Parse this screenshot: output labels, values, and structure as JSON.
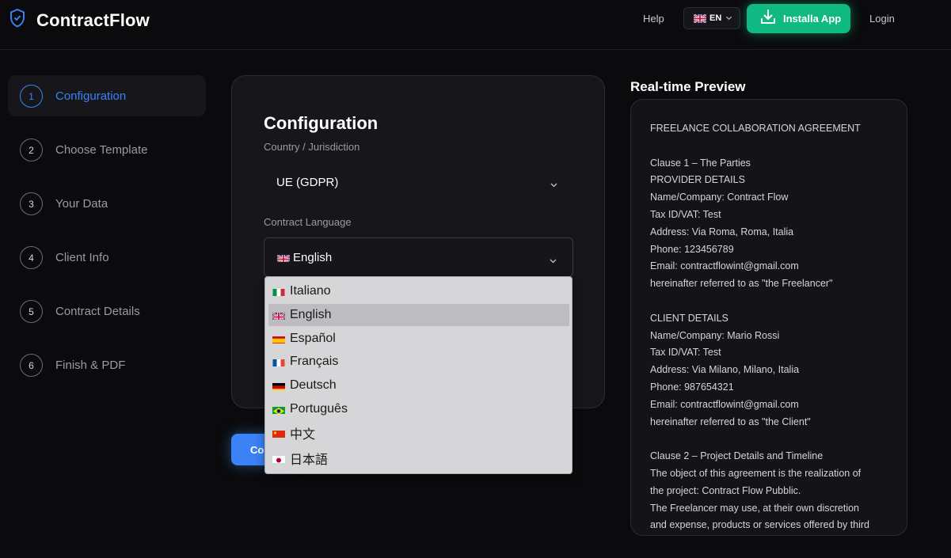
{
  "header": {
    "app_title": "ContractFlow",
    "help_label": "Help",
    "lang_button": "EN",
    "install_label": "Installa App",
    "login_label": "Login"
  },
  "steps": [
    {
      "num": "1",
      "label": "Configuration"
    },
    {
      "num": "2",
      "label": "Choose Template"
    },
    {
      "num": "3",
      "label": "Your Data"
    },
    {
      "num": "4",
      "label": "Client Info"
    },
    {
      "num": "5",
      "label": "Contract Details"
    },
    {
      "num": "6",
      "label": "Finish & PDF"
    }
  ],
  "config": {
    "title": "Configuration",
    "country_label": "Country / Jurisdiction",
    "country_value": "UE (GDPR)",
    "language_label": "Contract Language",
    "language_value": "English",
    "continue_label": "Co"
  },
  "language_options": [
    {
      "label": "Italiano",
      "flag": "it"
    },
    {
      "label": "English",
      "flag": "gb"
    },
    {
      "label": "Español",
      "flag": "es"
    },
    {
      "label": "Français",
      "flag": "fr"
    },
    {
      "label": "Deutsch",
      "flag": "de"
    },
    {
      "label": "Português",
      "flag": "br"
    },
    {
      "label": "中文",
      "flag": "cn"
    },
    {
      "label": "日本語",
      "flag": "jp"
    }
  ],
  "preview": {
    "title": "Real-time Preview",
    "lines": [
      "FREELANCE COLLABORATION AGREEMENT",
      "",
      "Clause 1 – The Parties",
      "PROVIDER DETAILS",
      "Name/Company: Contract Flow",
      "Tax ID/VAT: Test",
      "Address: Via Roma, Roma, Italia",
      "Phone: 123456789",
      "Email: contractflowint@gmail.com",
      "hereinafter referred to as \"the Freelancer\"",
      "",
      "CLIENT DETAILS",
      "Name/Company: Mario Rossi",
      "Tax ID/VAT: Test",
      "Address: Via Milano, Milano, Italia",
      "Phone: 987654321",
      "Email: contractflowint@gmail.com",
      "hereinafter referred to as \"the Client\"",
      "",
      "Clause 2 – Project Details and Timeline",
      "The object of this agreement is the realization of",
      "the project: Contract Flow Pubblic.",
      "The Freelancer may use, at their own discretion",
      "and expense, products or services offered by third"
    ]
  },
  "colors": {
    "accent": "#3b82f6",
    "install": "#10b981",
    "background": "#0b0b0d"
  }
}
